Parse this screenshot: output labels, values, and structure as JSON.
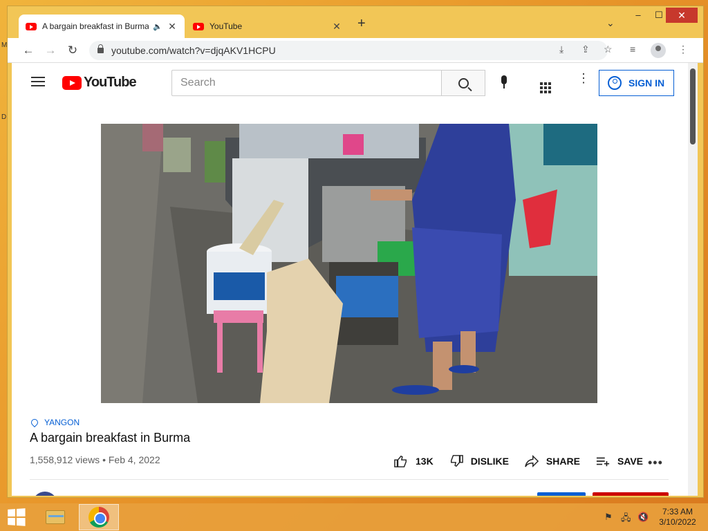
{
  "desktop": {
    "letter1": "M",
    "letter2": "D"
  },
  "browser": {
    "tabs": [
      {
        "title": "A bargain breakfast in Burma",
        "active": true
      },
      {
        "title": "YouTube",
        "active": false
      }
    ],
    "new_tab": "+",
    "url": "youtube.com/watch?v=djqAKV1HCPU",
    "window_controls": {
      "minimize": "‒",
      "maximize": "☐",
      "close": "✕"
    }
  },
  "youtube": {
    "logo_text": "YouTube",
    "search_placeholder": "Search",
    "sign_in": "SIGN IN"
  },
  "video": {
    "location": "YANGON",
    "title": "A bargain breakfast in Burma",
    "views": "1,558,912 views",
    "separator": "•",
    "date": "Feb 4, 2022",
    "actions": {
      "like_count": "13K",
      "dislike": "DISLIKE",
      "share": "SHARE",
      "save": "SAVE",
      "more": "•••"
    }
  },
  "taskbar": {
    "clock_time": "7:33 AM",
    "clock_date": "3/10/2022"
  },
  "colors": {
    "youtube_red": "#ff0000",
    "link_blue": "#065fd4",
    "desktop_orange": "#f0b43c"
  }
}
